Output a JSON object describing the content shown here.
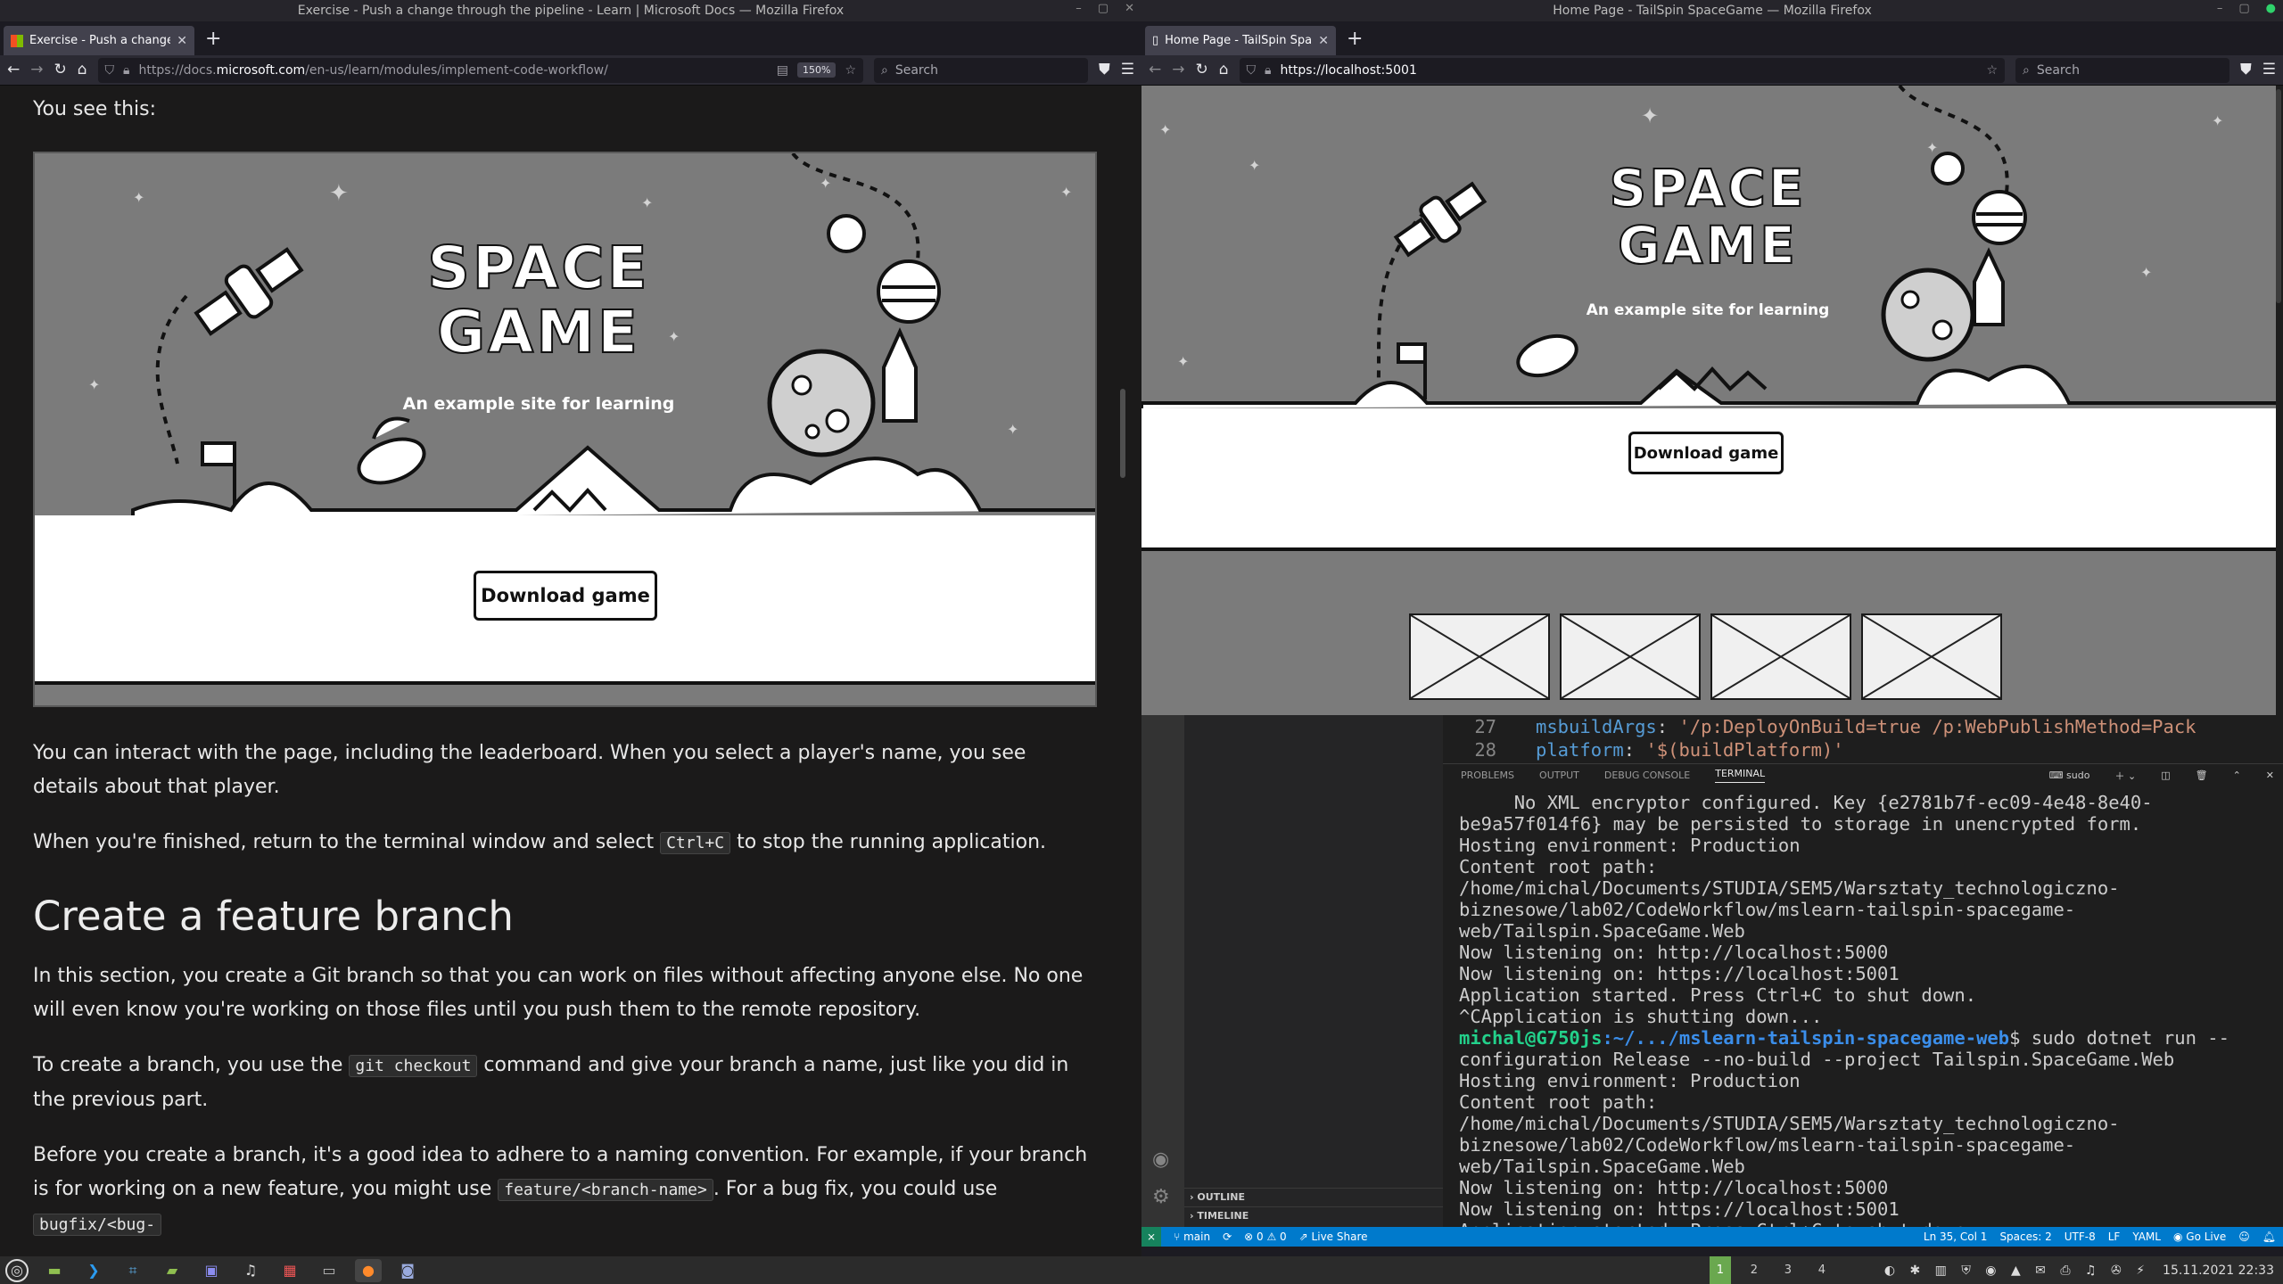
{
  "left_window": {
    "title": "Exercise - Push a change through the pipeline - Learn | Microsoft Docs — Mozilla Firefox",
    "tab_label": "Exercise - Push a change through the pipeline",
    "url_prefix": "https://docs.",
    "url_domain": "microsoft.com",
    "url_rest": "/en-us/learn/modules/implement-code-workflow/",
    "zoom": "150%",
    "search_placeholder": "Search"
  },
  "right_window": {
    "title": "Home Page - TailSpin SpaceGame — Mozilla Firefox",
    "tab_label": "Home Page - TailSpin SpaceGame",
    "url": "https://localhost:5001",
    "search_placeholder": "Search"
  },
  "doc": {
    "intro": "You see this:",
    "p1": "You can interact with the page, including the leaderboard. When you select a player's name, you see details about that player.",
    "p2_before": "When you're finished, return to the terminal window and select ",
    "p2_code": "Ctrl+C",
    "p2_after": " to stop the running application.",
    "heading": "Create a feature branch",
    "p3": "In this section, you create a Git branch so that you can work on files without affecting anyone else. No one will even know you're working on those files until you push them to the remote repository.",
    "p4_before": "To create a branch, you use the ",
    "p4_code": "git checkout",
    "p4_after": " command and give your branch a name, just like you did in the previous part.",
    "p5_before": "Before you create a branch, it's a good idea to adhere to a naming convention. For example, if your branch is for working on a new feature, you might use ",
    "p5_code1": "feature/<branch-name>",
    "p5_mid": ". For a bug fix, you could use ",
    "p5_code2": "bugfix/<bug-"
  },
  "game": {
    "title_line1": "SPACE",
    "title_line2": "GAME",
    "subtitle": "An example site for learning",
    "download_label": "Download game"
  },
  "editor": {
    "line_numbers": [
      "27",
      "28"
    ],
    "code_line_27_key": "msbuildArgs",
    "code_line_27_value": "'/p:DeployOnBuild=true /p:WebPublishMethod=Pack",
    "code_line_28_key": "platform",
    "code_line_28_value": "'$(buildPlatform)'",
    "panel_tabs": [
      "PROBLEMS",
      "OUTPUT",
      "DEBUG CONSOLE",
      "TERMINAL"
    ],
    "active_panel": "TERMINAL",
    "terminal_shell": "sudo",
    "sidebar_sections": [
      "OUTLINE",
      "TIMELINE"
    ]
  },
  "terminal": {
    "lines_a": "     No XML encryptor configured. Key {e2781b7f-ec09-4e48-8e40-be9a57f014f6} may be persisted to storage in unencrypted form.\nHosting environment: Production\nContent root path: /home/michal/Documents/STUDIA/SEM5/Warsztaty_technologiczno-biznesowe/lab02/CodeWorkflow/mslearn-tailspin-spacegame-web/Tailspin.SpaceGame.Web\nNow listening on: http://localhost:5000\nNow listening on: https://localhost:5001\nApplication started. Press Ctrl+C to shut down.\n^CApplication is shutting down...",
    "prompt_user": "michal@G750js",
    "prompt_path": ":~/.../mslearn-tailspin-spacegame-web",
    "prompt_cmd": "$ sudo dotnet run --configuration Release --no-build --project Tailspin.SpaceGame.Web",
    "lines_b": "Hosting environment: Production\nContent root path: /home/michal/Documents/STUDIA/SEM5/Warsztaty_technologiczno-biznesowe/lab02/CodeWorkflow/mslearn-tailspin-spacegame-web/Tailspin.SpaceGame.Web\nNow listening on: http://localhost:5000\nNow listening on: https://localhost:5001\nApplication started. Press Ctrl+C to shut down."
  },
  "statusbar": {
    "branch": "main",
    "problems": "0",
    "warnings": "0",
    "live_share": "Live Share",
    "cursor": "Ln 35, Col 1",
    "spaces": "Spaces: 2",
    "encoding": "UTF-8",
    "eol": "LF",
    "language": "YAML",
    "go_live": "Go Live"
  },
  "taskbar": {
    "workspaces": [
      "1",
      "2",
      "3",
      "4"
    ],
    "active_workspace": "1",
    "datetime": "15.11.2021 22:33"
  },
  "colors": {
    "vscode_status": "#007acc",
    "terminal_prompt_user": "#23d18b",
    "terminal_prompt_path": "#3b8eea",
    "yaml_key": "#569cd6",
    "yaml_string": "#ce9178"
  }
}
